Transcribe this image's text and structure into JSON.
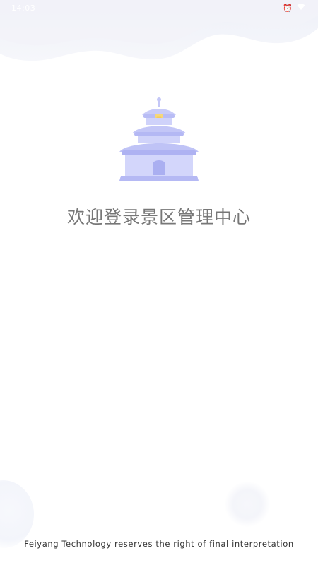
{
  "status_bar": {
    "time": "14:03",
    "icons": [
      "alarm-icon",
      "wifi-icon"
    ]
  },
  "welcome_text": "欢迎登录景区管理中心",
  "footer_text": "Feiyang Technology reserves the right of final interpretation",
  "colors": {
    "background": "#ffffff",
    "temple_light": "#d3d6fb",
    "temple_mid": "#b9bdf6",
    "temple_dark": "#a7acf0",
    "temple_accent": "#f6d77a",
    "welcome_text": "#777777",
    "footer_text": "#333333"
  }
}
